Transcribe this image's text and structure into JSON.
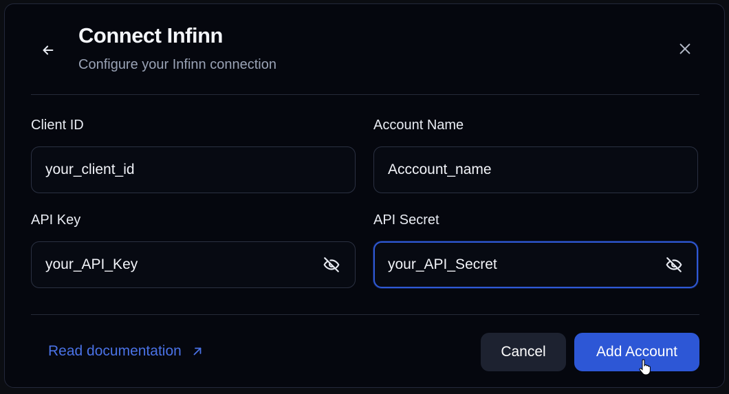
{
  "header": {
    "title": "Connect Infinn",
    "subtitle": "Configure your Infinn connection",
    "back_icon": "arrow-left-icon",
    "close_icon": "close-icon"
  },
  "form": {
    "client_id": {
      "label": "Client ID",
      "value": "your_client_id"
    },
    "account_name": {
      "label": "Account Name",
      "value": "Acccount_name"
    },
    "api_key": {
      "label": "API Key",
      "value": "your_API_Key",
      "icon": "eye-off-icon"
    },
    "api_secret": {
      "label": "API Secret",
      "value": "your_API_Secret",
      "icon": "eye-off-icon",
      "focused": true
    }
  },
  "footer": {
    "doc_link": "Read documentation",
    "doc_icon": "arrow-up-right-icon",
    "cancel_label": "Cancel",
    "add_label": "Add Account"
  },
  "colors": {
    "background": "#05070e",
    "accent": "#2d57d6",
    "link": "#4a72e6",
    "cancel_bg": "#1d2230"
  }
}
